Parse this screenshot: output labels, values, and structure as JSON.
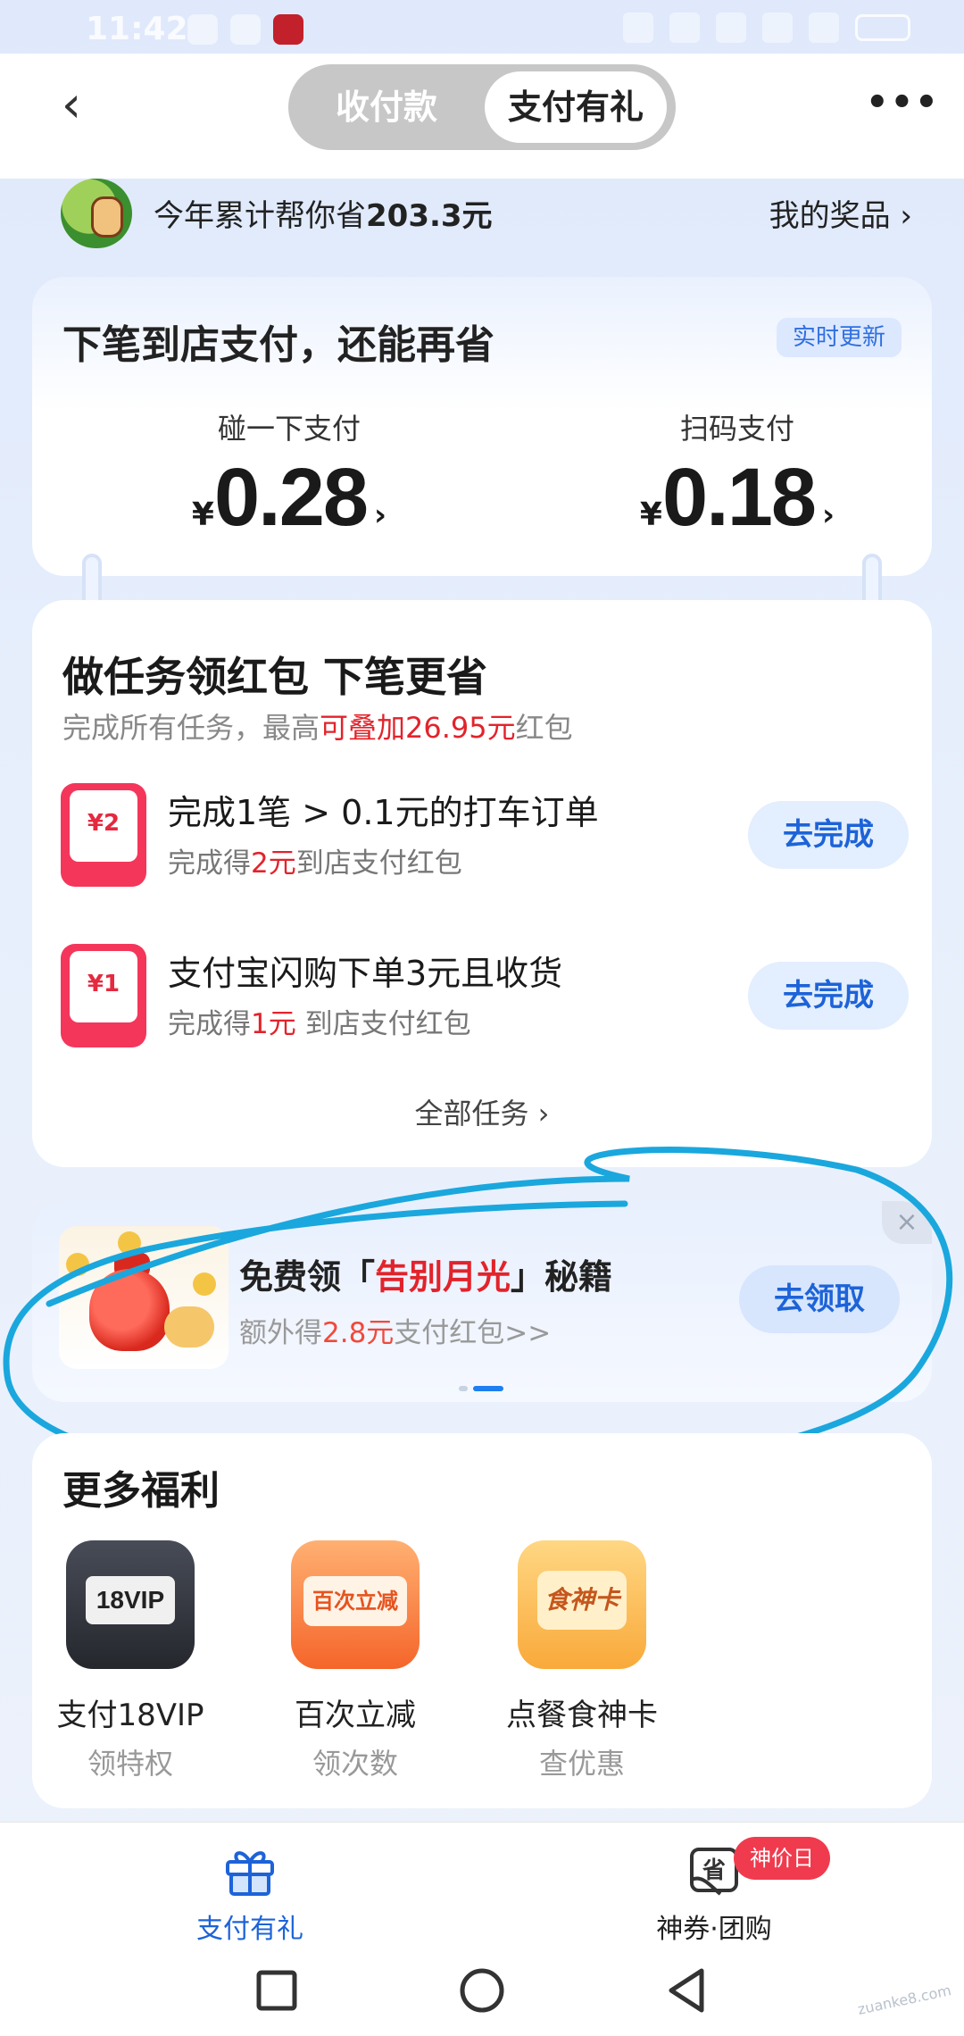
{
  "status_bar": {
    "time": "11:42"
  },
  "header": {
    "back_icon": "back-arrow-icon",
    "tabs": [
      {
        "label": "收付款",
        "active": false
      },
      {
        "label": "支付有礼",
        "active": true
      }
    ],
    "more_icon": "more-dots-icon"
  },
  "savings": {
    "prefix": "今年累计帮你省",
    "amount": "203.3元",
    "my_prizes": "我的奖品 ›"
  },
  "store_pay": {
    "title": "下笔到店支付，还能再省",
    "badge": "实时更新",
    "options": [
      {
        "label": "碰一下支付",
        "currency": "¥",
        "amount": "0.28",
        "arrow": "›"
      },
      {
        "label": "扫码支付",
        "currency": "¥",
        "amount": "0.18",
        "arrow": "›"
      }
    ]
  },
  "tasks": {
    "title": "做任务领红包 下笔更省",
    "subtitle_prefix": "完成所有任务，最高",
    "subtitle_highlight": "可叠加26.95元",
    "subtitle_suffix": "红包",
    "items": [
      {
        "packet": "¥2",
        "title": "完成1笔 > 0.1元的打车订单",
        "sub_prefix": "完成得",
        "sub_highlight": "2元",
        "sub_suffix": "到店支付红包",
        "button": "去完成"
      },
      {
        "packet": "¥1",
        "title": "支付宝闪购下单3元且收货",
        "sub_prefix": "完成得",
        "sub_highlight": "1元",
        "sub_suffix": " 到店支付红包",
        "button": "去完成"
      }
    ],
    "all_tasks": "全部任务 ›"
  },
  "promo": {
    "title_prefix": "免费领「",
    "title_highlight": "告别月光",
    "title_suffix": "」秘籍",
    "sub_prefix": "额外得",
    "sub_highlight": "2.8元",
    "sub_suffix": "支付红包>>",
    "button": "去领取",
    "close": "×",
    "annotation_color": "#1aa7dd"
  },
  "more_benefits": {
    "title": "更多福利",
    "items": [
      {
        "icon_text": "18VIP",
        "name": "支付18VIP",
        "desc": "领特权"
      },
      {
        "icon_text": "百次立减",
        "name": "百次立减",
        "desc": "领次数"
      },
      {
        "icon_text": "食神卡",
        "name": "点餐食神卡",
        "desc": "查优惠"
      }
    ]
  },
  "bottom_nav": {
    "items": [
      {
        "label": "支付有礼",
        "icon": "gift-icon",
        "active": true
      },
      {
        "label": "神券·团购",
        "icon": "coupon-save-icon",
        "active": false
      }
    ],
    "badge": "神价日",
    "coupon_icon_text": "省"
  },
  "watermark": "zuanke8.com",
  "colors": {
    "accent_blue": "#1d63d8",
    "highlight_red": "#e2232b",
    "packet_red": "#f4365a"
  }
}
